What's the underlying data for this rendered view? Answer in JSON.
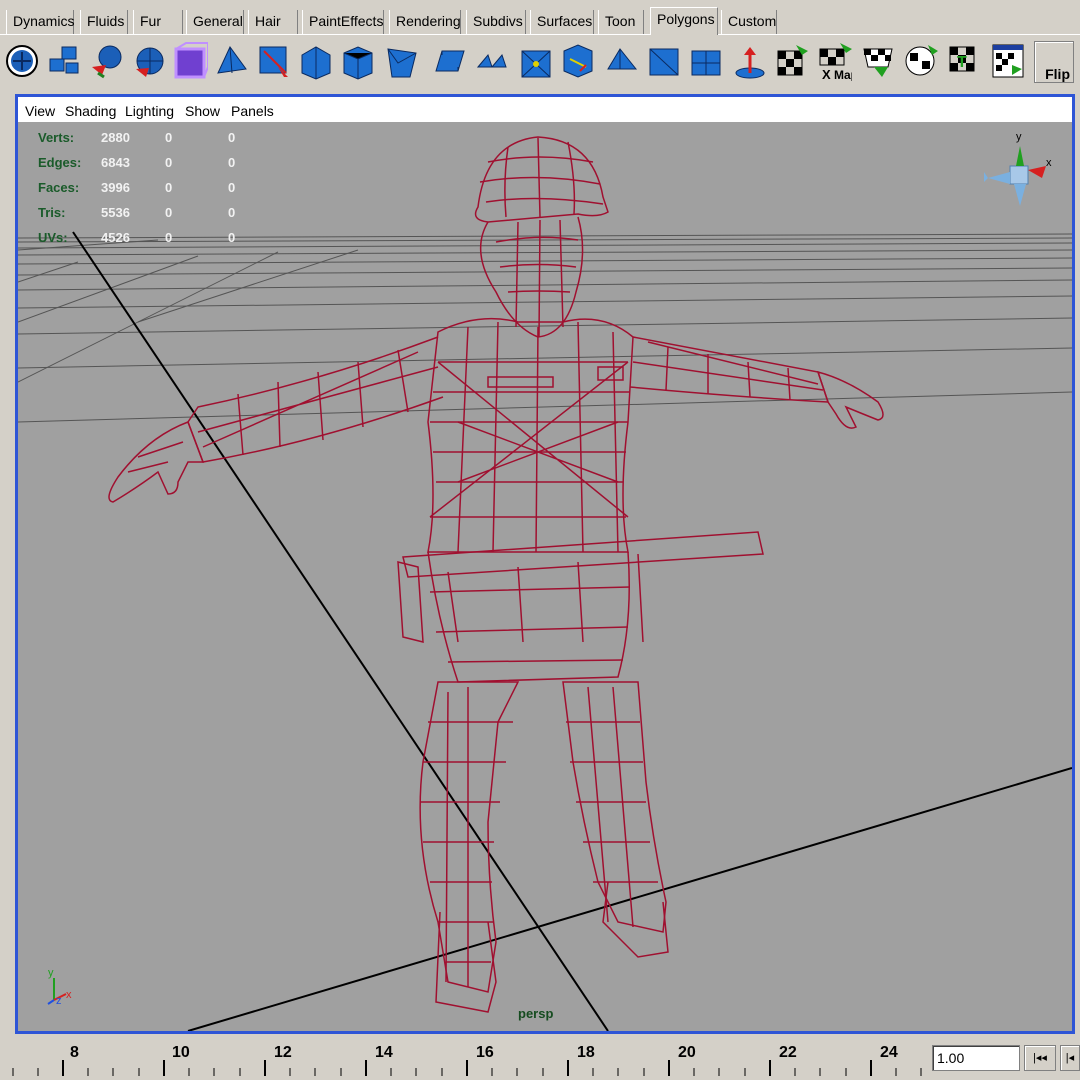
{
  "shelf_tabs": [
    "Dynamics",
    "Fluids",
    "Fur",
    "General",
    "Hair",
    "PaintEffects",
    "Rendering",
    "Subdivs",
    "Surfaces",
    "Toon",
    "Polygons",
    "Custom"
  ],
  "active_tab": "Polygons",
  "shelf": {
    "icons": [
      "select-poly-icon",
      "split-icon",
      "extrude-icon",
      "sphere-icon",
      "cube-icon",
      "wedge-icon",
      "cut-icon",
      "bevel-icon",
      "merge-icon",
      "smooth-icon",
      "bridge-icon",
      "append-icon",
      "poke-icon",
      "chip-icon",
      "duplicate-icon",
      "triangulate-icon",
      "quadrangulate-icon",
      "center-pivot-icon",
      "uv-planar-icon",
      "uv-auto-map-icon",
      "uv-cylindrical-icon",
      "uv-spherical-icon",
      "uv-texture-icon",
      "uv-editor-icon"
    ],
    "map_label": "Map",
    "flip_label": "Flip"
  },
  "viewport": {
    "menu": [
      "View",
      "Shading",
      "Lighting",
      "Show",
      "Panels"
    ],
    "camera_label": "persp",
    "stats": [
      {
        "label": "Verts:",
        "values": [
          "2880",
          "0",
          "0"
        ]
      },
      {
        "label": "Edges:",
        "values": [
          "6843",
          "0",
          "0"
        ]
      },
      {
        "label": "Faces:",
        "values": [
          "3996",
          "0",
          "0"
        ]
      },
      {
        "label": "Tris:",
        "values": [
          "5536",
          "0",
          "0"
        ]
      },
      {
        "label": "UVs:",
        "values": [
          "4526",
          "0",
          "0"
        ]
      }
    ],
    "gizmo_axes": [
      "y",
      "x"
    ],
    "origin_axes": [
      "y",
      "z",
      "x"
    ],
    "colors": {
      "wireframe": "#a01030",
      "background": "#a0a0a0",
      "border": "#2e55d6"
    }
  },
  "timeline": {
    "ticks": [
      "8",
      "10",
      "12",
      "14",
      "16",
      "18",
      "20",
      "22",
      "24"
    ],
    "current_frame": "1.00",
    "prev_key_button": "|◂◂",
    "next_button": "|◂"
  }
}
